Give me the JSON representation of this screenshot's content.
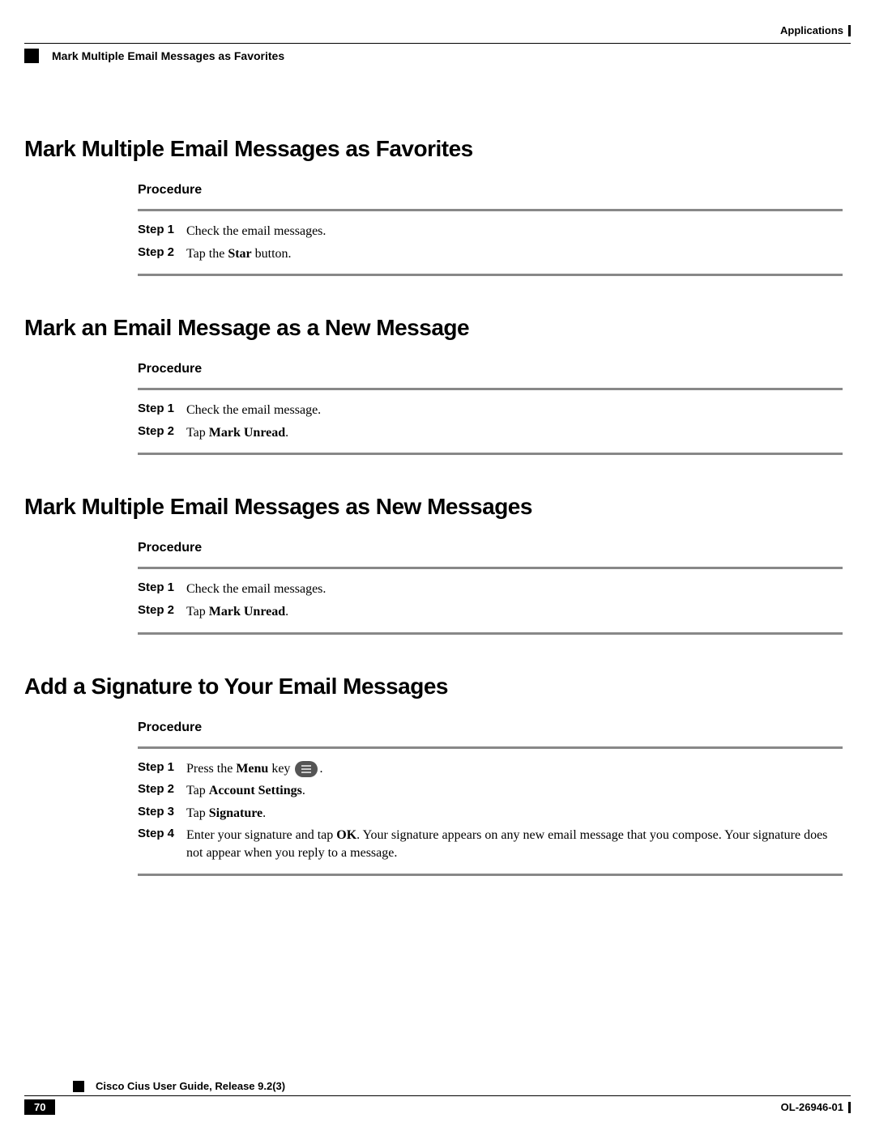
{
  "header": {
    "chapter": "Applications",
    "breadcrumb": "Mark Multiple Email Messages as Favorites"
  },
  "sections": [
    {
      "title": "Mark Multiple Email Messages as Favorites",
      "procedure_label": "Procedure",
      "steps": [
        {
          "label": "Step 1",
          "text_pre": "Check the email messages.",
          "bold": "",
          "text_post": ""
        },
        {
          "label": "Step 2",
          "text_pre": "Tap the ",
          "bold": "Star",
          "text_post": " button."
        }
      ]
    },
    {
      "title": "Mark an Email Message as a New Message",
      "procedure_label": "Procedure",
      "steps": [
        {
          "label": "Step 1",
          "text_pre": "Check the email message.",
          "bold": "",
          "text_post": ""
        },
        {
          "label": "Step 2",
          "text_pre": "Tap ",
          "bold": "Mark Unread",
          "text_post": "."
        }
      ]
    },
    {
      "title": "Mark Multiple Email Messages as New Messages",
      "procedure_label": "Procedure",
      "steps": [
        {
          "label": "Step 1",
          "text_pre": "Check the email messages.",
          "bold": "",
          "text_post": ""
        },
        {
          "label": "Step 2",
          "text_pre": "Tap ",
          "bold": "Mark Unread",
          "text_post": "."
        }
      ]
    },
    {
      "title": "Add a Signature to Your Email Messages",
      "procedure_label": "Procedure",
      "steps_signature": {
        "s1_label": "Step 1",
        "s1_pre": "Press the ",
        "s1_bold": "Menu",
        "s1_mid": " key ",
        "s1_post": ".",
        "s2_label": "Step 2",
        "s2_pre": "Tap ",
        "s2_bold": "Account Settings",
        "s2_post": ".",
        "s3_label": "Step 3",
        "s3_pre": "Tap ",
        "s3_bold": "Signature",
        "s3_post": ".",
        "s4_label": "Step 4",
        "s4_pre": "Enter your signature and tap ",
        "s4_bold": "OK",
        "s4_post": ". Your signature appears on any new email message that you compose. Your signature does not appear when you reply to a message."
      }
    }
  ],
  "footer": {
    "guide_title": "Cisco Cius User Guide, Release 9.2(3)",
    "page_number": "70",
    "doc_id": "OL-26946-01"
  }
}
